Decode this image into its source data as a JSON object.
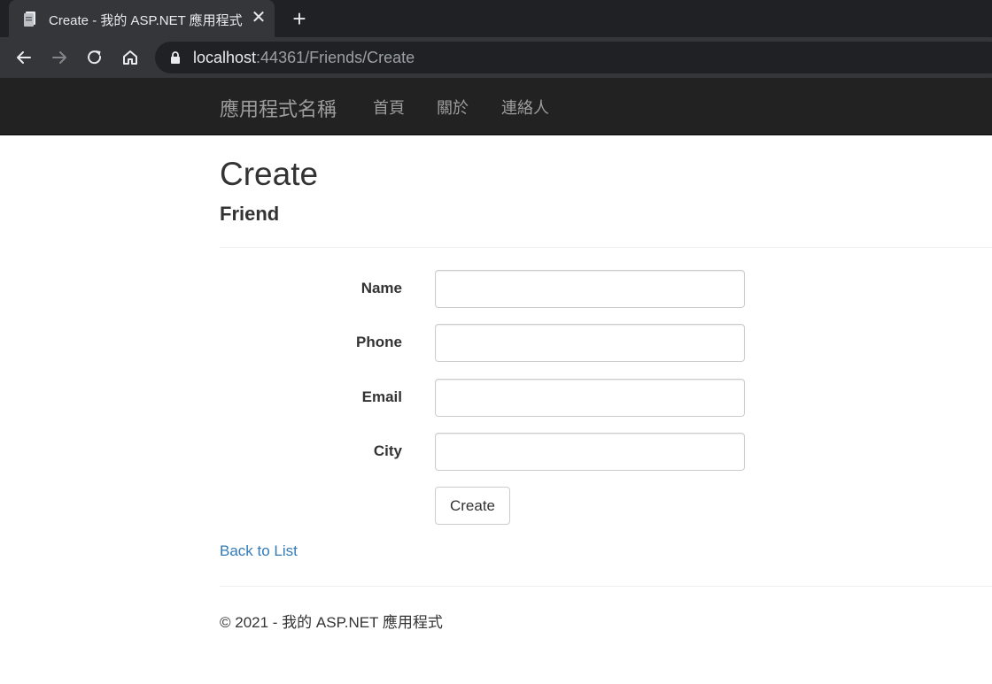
{
  "browser": {
    "tab": {
      "title": "Create - 我的 ASP.NET 應用程式",
      "close_glyph": "✕",
      "favicon": "page-icon"
    },
    "new_tab_glyph": "+",
    "toolbar": {
      "back": "back-arrow-icon",
      "forward": "forward-arrow-icon",
      "reload": "reload-icon",
      "home": "home-icon"
    },
    "address": {
      "host": "localhost",
      "rest": ":44361/Friends/Create"
    },
    "colors": {
      "tabstrip": "#202124",
      "toolbar": "#35363a"
    }
  },
  "navbar": {
    "brand": "應用程式名稱",
    "links": [
      "首頁",
      "關於",
      "連絡人"
    ],
    "colors": {
      "background": "#222222",
      "text": "#9d9d9d"
    }
  },
  "page": {
    "title": "Create",
    "subtitle": "Friend"
  },
  "form": {
    "fields": [
      {
        "label": "Name",
        "value": ""
      },
      {
        "label": "Phone",
        "value": ""
      },
      {
        "label": "Email",
        "value": ""
      },
      {
        "label": "City",
        "value": ""
      }
    ],
    "submit_label": "Create"
  },
  "back_link": "Back to List",
  "footer": "© 2021 - 我的 ASP.NET 應用程式",
  "colors": {
    "link": "#337ab7",
    "text": "#333333"
  }
}
